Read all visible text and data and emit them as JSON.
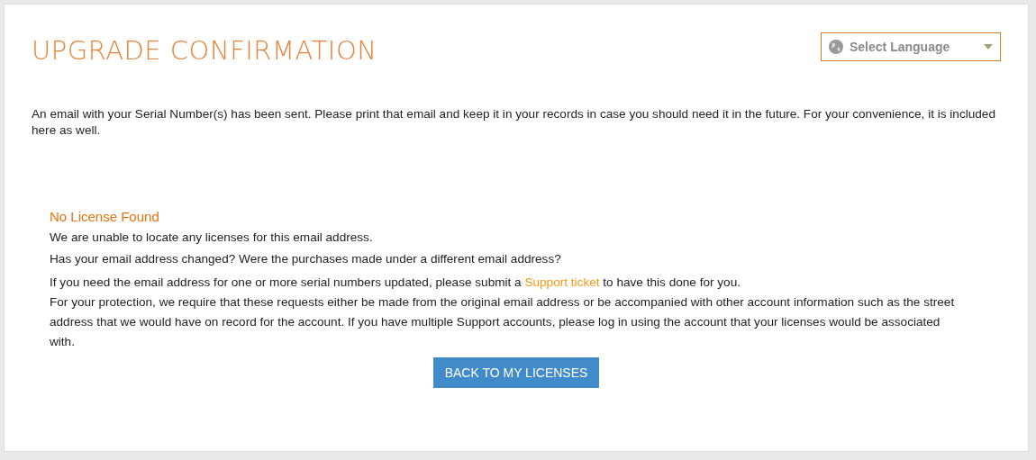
{
  "title": "UPGRADE CONFIRMATION",
  "language_select": {
    "placeholder": "Select Language"
  },
  "intro": "An email with your Serial Number(s) has been sent. Please print that email and keep it in your records in case you should need it in the future. For your convenience, it is included here as well.",
  "notice": {
    "heading": "No License Found",
    "lines": [
      "We are unable to locate any licenses for this email address.",
      "Has your email address changed? Were the purchases made under a different email address?"
    ],
    "request": {
      "before": "If you need the email address for one or more serial numbers updated, please submit a ",
      "link": "Support ticket",
      "after": " to have this done for you."
    },
    "protection": "For your protection, we require that these requests either be made from the original email address or be accompanied with other account information such as the street address that we would have on record for the account. If you have multiple Support accounts, please log in using the account that your licenses would be associated with."
  },
  "button": "BACK TO MY LICENSES"
}
